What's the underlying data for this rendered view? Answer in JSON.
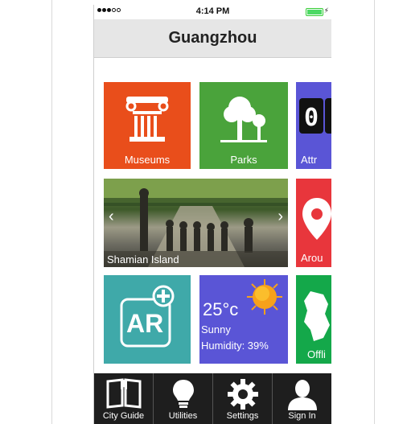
{
  "status_bar": {
    "time": "4:14 PM"
  },
  "header": {
    "title": "Guangzhou"
  },
  "tiles": {
    "museums": {
      "label": "Museums",
      "color": "#e94e1b"
    },
    "parks": {
      "label": "Parks",
      "color": "#4aa33b"
    },
    "attractions": {
      "label": "Attr",
      "color": "#5a55d6"
    },
    "photo": {
      "label": "Shamian Island"
    },
    "around": {
      "label": "Arou",
      "color": "#e8363c"
    },
    "ar": {
      "label": "AR",
      "color": "#3fa9a9"
    },
    "weather": {
      "temp": "25°c",
      "condition": "Sunny",
      "humidity": "Humidity: 39%",
      "color": "#5a55d6"
    },
    "offline": {
      "label": "Offli",
      "color": "#14a84a"
    }
  },
  "tabbar": {
    "items": [
      {
        "label": "City Guide",
        "icon": "book-icon"
      },
      {
        "label": "Utilities",
        "icon": "lightbulb-icon"
      },
      {
        "label": "Settings",
        "icon": "gear-icon"
      },
      {
        "label": "Sign In",
        "icon": "person-icon"
      }
    ]
  }
}
